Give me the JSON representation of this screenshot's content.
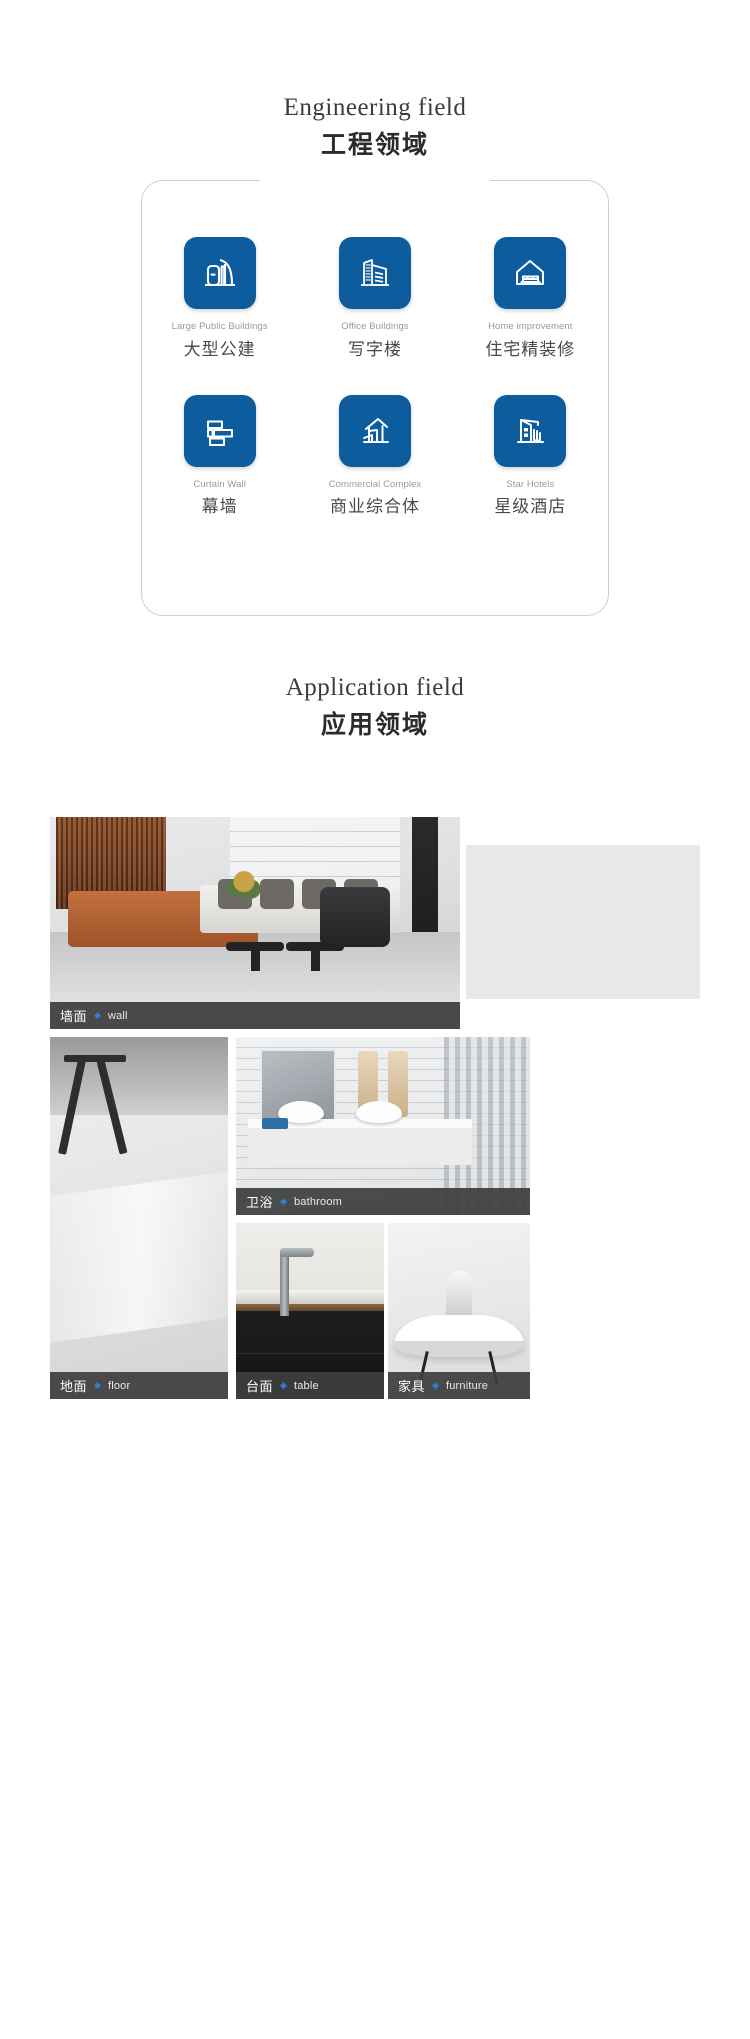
{
  "engineering": {
    "title_en": "Engineering field",
    "title_cn": "工程领域",
    "items": [
      {
        "icon": "large-public-building-icon",
        "label_en": "Large Public Buildings",
        "label_cn": "大型公建"
      },
      {
        "icon": "office-building-icon",
        "label_en": "Office Buildings",
        "label_cn": "写字楼"
      },
      {
        "icon": "home-improvement-icon",
        "label_en": "Home  improvement",
        "label_cn": "住宅精装修"
      },
      {
        "icon": "curtain-wall-icon",
        "label_en": "Curtain Wall",
        "label_cn": "幕墙"
      },
      {
        "icon": "commercial-complex-icon",
        "label_en": "Commercial Complex",
        "label_cn": "商业综合体"
      },
      {
        "icon": "star-hotel-icon",
        "label_en": "Star Hotels",
        "label_cn": "星级酒店"
      }
    ]
  },
  "application": {
    "title_en": "Application field",
    "title_cn": "应用领域",
    "separator": "◆",
    "photos": [
      {
        "name": "wall",
        "caption_cn": "墙面",
        "caption_en": "wall"
      },
      {
        "name": "floor",
        "caption_cn": "地面",
        "caption_en": "floor"
      },
      {
        "name": "bathroom",
        "caption_cn": "卫浴",
        "caption_en": "bathroom"
      },
      {
        "name": "table",
        "caption_cn": "台面",
        "caption_en": "table"
      },
      {
        "name": "furniture",
        "caption_cn": "家具",
        "caption_en": "furniture"
      }
    ]
  },
  "colors": {
    "tile_blue": "#0d5c9e",
    "accent_blue": "#2f7fd6",
    "caption_bar": "#3e3e3e",
    "card_border": "#cfcfcf",
    "grey_panel": "#e9e9e9"
  }
}
